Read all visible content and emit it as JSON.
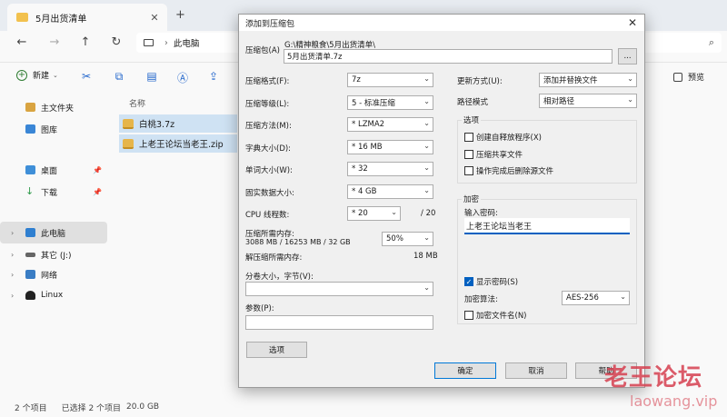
{
  "explorer": {
    "tab_title": "5月出货清单",
    "breadcrumb": "此电脑",
    "toolbar": {
      "new_label": "新建",
      "preview_label": "预览"
    },
    "column_name": "名称",
    "sidebar": [
      {
        "label": "主文件夹",
        "icon": "home-icon"
      },
      {
        "label": "图库",
        "icon": "gallery-icon"
      },
      {
        "label": "桌面",
        "icon": "desktop-icon",
        "pinned": true
      },
      {
        "label": "下载",
        "icon": "download-icon",
        "pinned": true
      },
      {
        "label": "此电脑",
        "icon": "pc-icon",
        "selected": true
      },
      {
        "label": "其它 (J:)",
        "icon": "drive-icon"
      },
      {
        "label": "网络",
        "icon": "network-icon"
      },
      {
        "label": "Linux",
        "icon": "linux-icon"
      }
    ],
    "files": [
      {
        "name": "白桃3.7z"
      },
      {
        "name": "上老王论坛当老王.zip"
      }
    ],
    "status": {
      "count": "2 个项目",
      "selected": "已选择 2 个项目",
      "size": "20.0 GB"
    }
  },
  "dialog": {
    "title": "添加到压缩包",
    "archive_label": "压缩包(A)",
    "archive_path": "G:\\精神粮食\\5月出货清单\\",
    "archive_name": "5月出货清单.7z",
    "browse_label": "...",
    "format_label": "压缩格式(F):",
    "format_value": "7z",
    "level_label": "压缩等级(L):",
    "level_value": "5 - 标准压缩",
    "method_label": "压缩方法(M):",
    "method_value": "* LZMA2",
    "dict_label": "字典大小(D):",
    "dict_value": "* 16 MB",
    "word_label": "单词大小(W):",
    "word_value": "* 32",
    "solid_label": "固实数据大小:",
    "solid_value": "* 4 GB",
    "threads_label": "CPU 线程数:",
    "threads_value": "* 20",
    "threads_max": "/ 20",
    "mem_label": "压缩所需内存:",
    "mem_detail": "3088 MB / 16253 MB / 32 GB",
    "mem_value": "50%",
    "decomp_label": "解压缩所需内存:",
    "decomp_value": "18 MB",
    "split_label": "分卷大小，字节(V):",
    "params_label": "参数(P):",
    "options_btn": "选项",
    "update_label": "更新方式(U):",
    "update_value": "添加并替换文件",
    "path_label": "路径模式",
    "path_value": "相对路径",
    "options_group": "选项",
    "opt_sfx": "创建自释放程序(X)",
    "opt_shared": "压缩共享文件",
    "opt_delete": "操作完成后删除源文件",
    "encrypt_group": "加密",
    "password_label": "输入密码:",
    "password_value": "上老王论坛当老王",
    "show_password": "显示密码(S)",
    "enc_method_label": "加密算法:",
    "enc_method_value": "AES-256",
    "encrypt_names": "加密文件名(N)",
    "ok": "确定",
    "cancel": "取消",
    "help": "帮助"
  },
  "watermark": {
    "text": "老王论坛",
    "url": "laowang.vip"
  }
}
